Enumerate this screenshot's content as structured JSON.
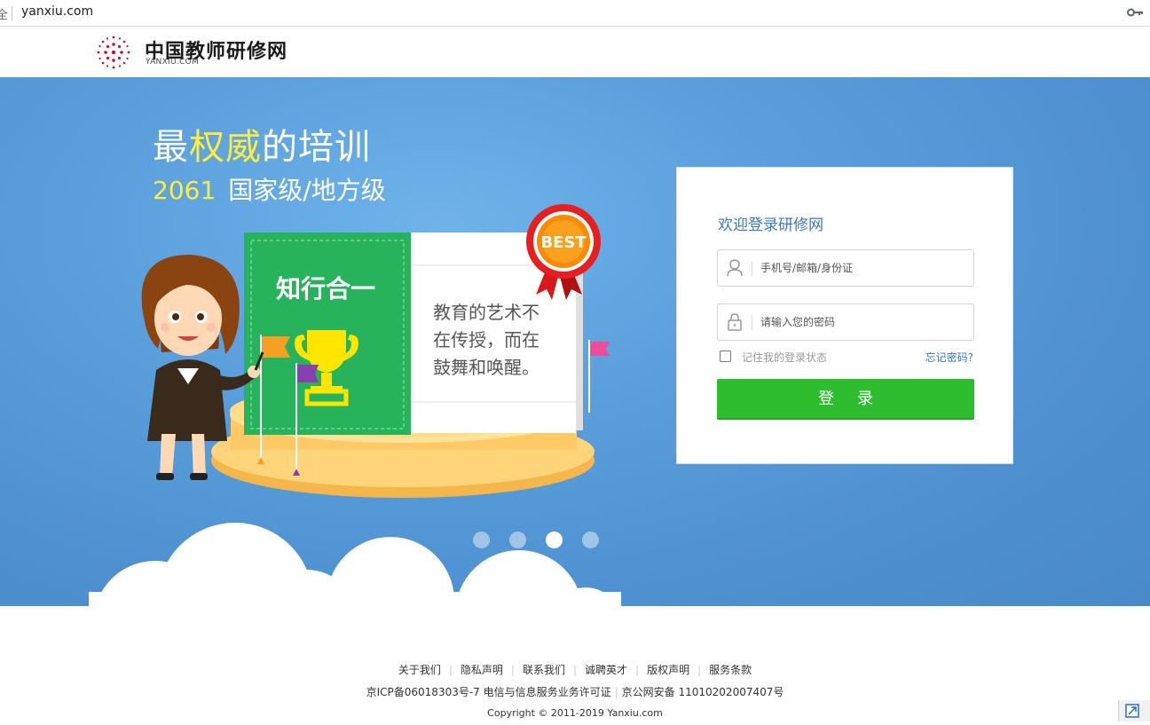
{
  "browser": {
    "lock_glyph": "全",
    "url": "yanxiu.com"
  },
  "header": {
    "logo_title": "中国教师研修网",
    "logo_subtitle": "YANXIU.COM"
  },
  "banner": {
    "slogan_pre": "最",
    "slogan_highlight": "权威",
    "slogan_post": "的培训",
    "count": "2061",
    "levels": "国家级/地方级",
    "book_cover": "知行合一",
    "book_page": "教育的艺术不在传授，而在鼓舞和唤醒。",
    "badge": "BEST",
    "carousel_active": 3,
    "carousel_count": 4
  },
  "login": {
    "title": "欢迎登录研修网",
    "username_placeholder": "手机号/邮箱/身份证",
    "password_placeholder": "请输入您的密码",
    "remember_label": "记住我的登录状态",
    "forgot_label": "忘记密码?",
    "submit_label": "登录"
  },
  "footer": {
    "links": [
      "关于我们",
      "隐私声明",
      "联系我们",
      "诚聘英才",
      "版权声明",
      "服务条款"
    ],
    "icp": "京ICP备06018303号-7 电信与信息服务业务许可证",
    "police": "京公网安备 11010202007407号",
    "copyright": "Copyright © 2011-2019 Yanxiu.com"
  },
  "colors": {
    "accent": "#3b78c0",
    "submit": "#2ebd2e",
    "banner_blue": "#5a9fdc",
    "highlight_yellow": "#ffec3d"
  }
}
